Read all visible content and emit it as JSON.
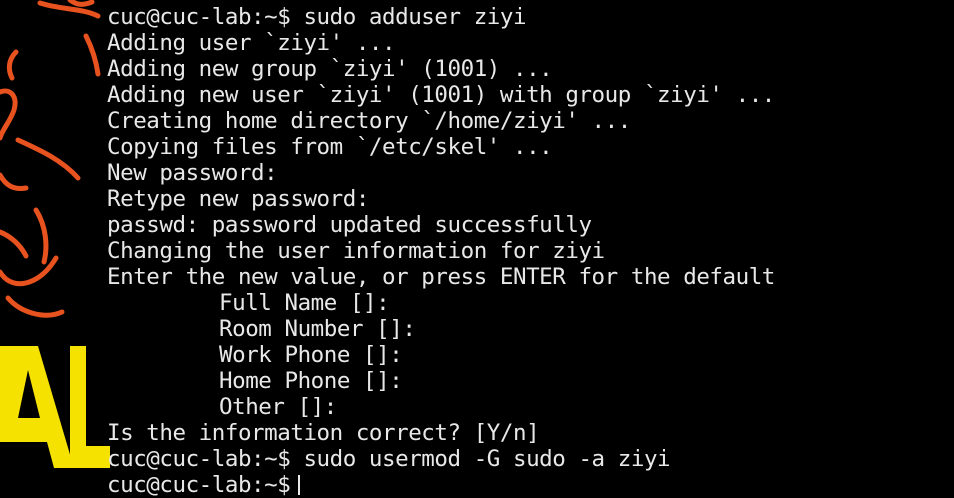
{
  "terminal": {
    "lines": [
      "cuc@cuc-lab:~$ sudo adduser ziyi",
      "Adding user `ziyi' ...",
      "Adding new group `ziyi' (1001) ...",
      "Adding new user `ziyi' (1001) with group `ziyi' ...",
      "Creating home directory `/home/ziyi' ...",
      "Copying files from `/etc/skel' ...",
      "New password:",
      "Retype new password:",
      "passwd: password updated successfully",
      "Changing the user information for ziyi",
      "Enter the new value, or press ENTER for the default",
      "Full Name []:",
      "Room Number []:",
      "Work Phone []:",
      "Home Phone []:",
      "Other []:",
      "Is the information correct? [Y/n]",
      "cuc@cuc-lab:~$ sudo usermod -G sudo -a ziyi",
      "cuc@cuc-lab:~$"
    ]
  },
  "colors": {
    "background": "#000000",
    "text": "#e8e8e8",
    "wallpaper_yellow": "#f5e200",
    "wallpaper_orange": "#e8521e"
  }
}
